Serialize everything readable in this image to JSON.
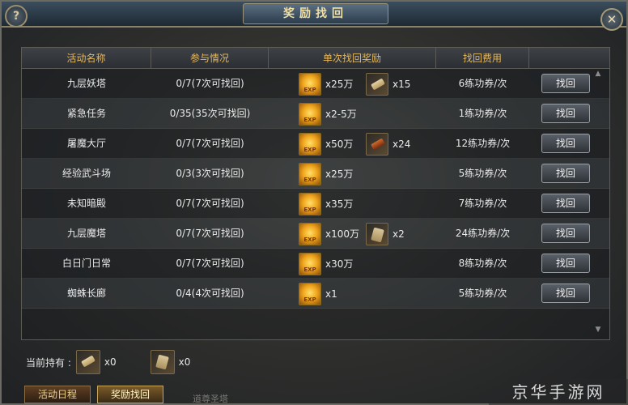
{
  "window": {
    "title": "奖励找回"
  },
  "table": {
    "headers": [
      "活动名称",
      "参与情况",
      "单次找回奖励",
      "找回费用"
    ],
    "rows": [
      {
        "name": "九层妖塔",
        "participation": "0/7(7次可找回)",
        "exp_qty": "x25万",
        "item_icon": "scroll-icon",
        "item_qty": "x15",
        "cost": "6练功券/次",
        "button": "找回"
      },
      {
        "name": "紧急任务",
        "participation": "0/35(35次可找回)",
        "exp_qty": "x2-5万",
        "item_icon": "",
        "item_qty": "",
        "cost": "1练功券/次",
        "button": "找回"
      },
      {
        "name": "屠魔大厅",
        "participation": "0/7(7次可找回)",
        "exp_qty": "x50万",
        "item_icon": "sword-icon",
        "item_qty": "x24",
        "cost": "12练功券/次",
        "button": "找回"
      },
      {
        "name": "经验武斗场",
        "participation": "0/3(3次可找回)",
        "exp_qty": "x25万",
        "item_icon": "",
        "item_qty": "",
        "cost": "5练功券/次",
        "button": "找回"
      },
      {
        "name": "未知暗殿",
        "participation": "0/7(7次可找回)",
        "exp_qty": "x35万",
        "item_icon": "",
        "item_qty": "",
        "cost": "7练功券/次",
        "button": "找回"
      },
      {
        "name": "九层魔塔",
        "participation": "0/7(7次可找回)",
        "exp_qty": "x100万",
        "item_icon": "paper-icon",
        "item_qty": "x2",
        "cost": "24练功券/次",
        "button": "找回"
      },
      {
        "name": "白日门日常",
        "participation": "0/7(7次可找回)",
        "exp_qty": "x30万",
        "item_icon": "",
        "item_qty": "",
        "cost": "8练功券/次",
        "button": "找回"
      },
      {
        "name": "蜘蛛长廊",
        "participation": "0/4(4次可找回)",
        "exp_qty": "x1",
        "item_icon": "",
        "item_qty": "",
        "cost": "5练功券/次",
        "button": "找回"
      }
    ]
  },
  "exp_label": "EXP",
  "holding": {
    "label": "当前持有 :",
    "items": [
      {
        "icon": "scroll-icon",
        "qty": "x0"
      },
      {
        "icon": "paper-icon",
        "qty": "x0"
      }
    ]
  },
  "tabs": [
    {
      "label": "活动日程"
    },
    {
      "label": "奖励找回"
    }
  ],
  "background_text": "道尊圣塔",
  "watermark": "京华手游网",
  "buttons": {
    "help": "?",
    "close": "✕"
  }
}
